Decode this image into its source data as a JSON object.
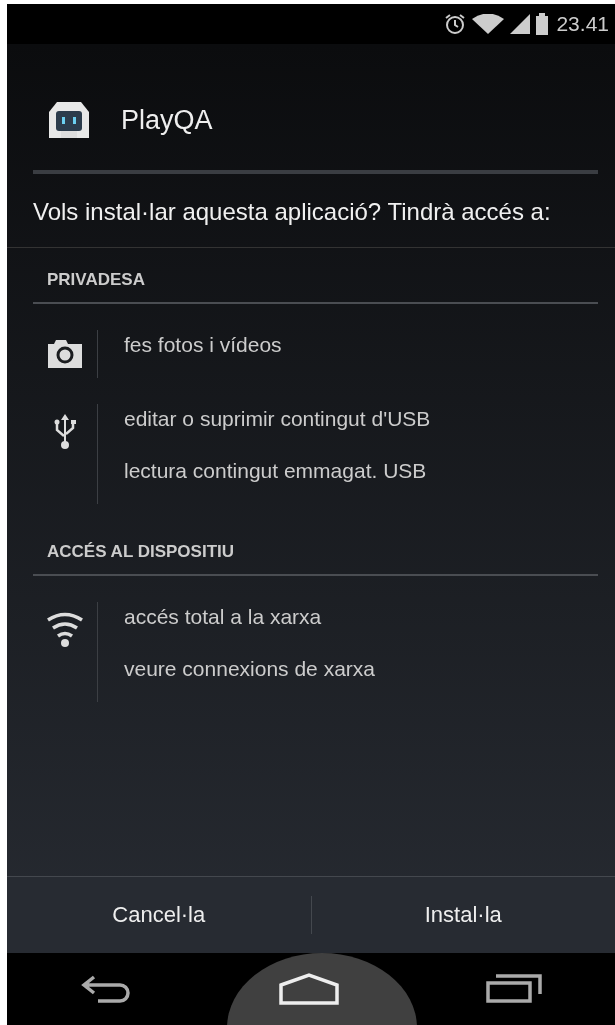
{
  "status_bar": {
    "time": "23.41"
  },
  "app": {
    "name": "PlayQA"
  },
  "question": "Vols instal·lar aquesta aplicació? Tindrà accés a:",
  "sections": [
    {
      "title": "PRIVADESA",
      "groups": [
        {
          "kind": "camera",
          "permissions": [
            "fes fotos i vídeos"
          ]
        },
        {
          "kind": "usb",
          "permissions": [
            "editar o suprimir contingut d'USB",
            "lectura contingut emmagat. USB"
          ]
        }
      ]
    },
    {
      "title": "ACCÉS AL DISPOSITIU",
      "groups": [
        {
          "kind": "wifi",
          "permissions": [
            "accés total a la xarxa",
            "veure connexions de xarxa"
          ]
        }
      ]
    }
  ],
  "buttons": [
    "Cancel·la",
    "Instal·la"
  ]
}
